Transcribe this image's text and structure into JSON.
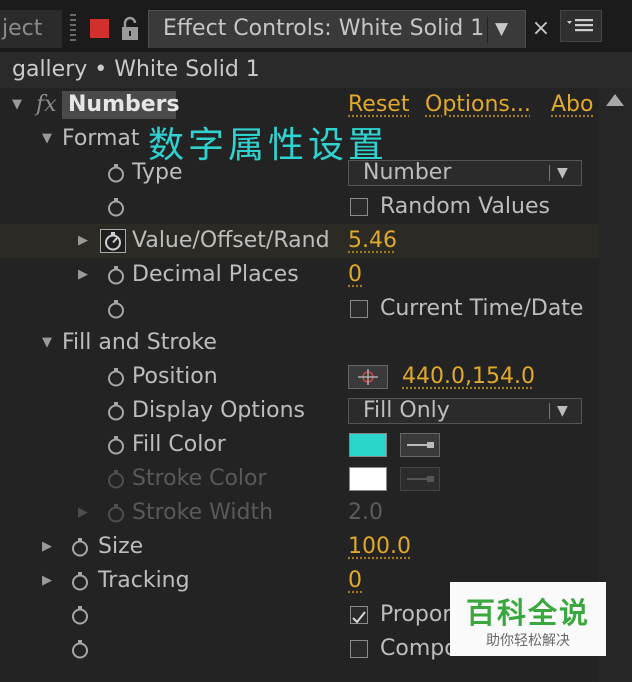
{
  "tabs": {
    "project_label": "ject",
    "effect_controls_label": "Effect Controls: White Solid 1",
    "close_glyph": "×",
    "dropdown_glyph": "▼"
  },
  "layer_header": {
    "title": "gallery • White Solid 1"
  },
  "effect": {
    "fx_glyph": "fx",
    "name": "Numbers",
    "reset_label": "Reset",
    "options_label": "Options...",
    "about_label": "Abo"
  },
  "overlay_text": "数字属性设置",
  "format": {
    "group_label": "Format",
    "type_label": "Type",
    "type_value": "Number",
    "random_values_label": "Random Values",
    "random_values_checked": false,
    "value_offset_label": "Value/Offset/Rand",
    "value_offset_value": "5.46",
    "decimal_places_label": "Decimal Places",
    "decimal_places_value": "0",
    "current_time_label": "Current Time/Date",
    "current_time_checked": false
  },
  "fill_and_stroke": {
    "group_label": "Fill and Stroke",
    "position_label": "Position",
    "position_value": "440.0,154.0",
    "display_options_label": "Display Options",
    "display_options_value": "Fill Only",
    "fill_color_label": "Fill Color",
    "fill_color": "#2ad6cc",
    "stroke_color_label": "Stroke Color",
    "stroke_color": "#ffffff",
    "stroke_width_label": "Stroke Width",
    "stroke_width_value": "2.0"
  },
  "size": {
    "label": "Size",
    "value": "100.0"
  },
  "tracking": {
    "label": "Tracking",
    "value": "0"
  },
  "proportional": {
    "label": "Propor",
    "checked": true
  },
  "composite": {
    "label": "Compo",
    "checked": false
  },
  "watermark": {
    "title": "百科全说",
    "subtitle": "助你轻松解决"
  },
  "colors": {
    "panel_bg": "#232323",
    "value_orange": "#e0a92c",
    "overlay_cyan": "#2fd2cf",
    "tab_red": "#d2302c"
  }
}
